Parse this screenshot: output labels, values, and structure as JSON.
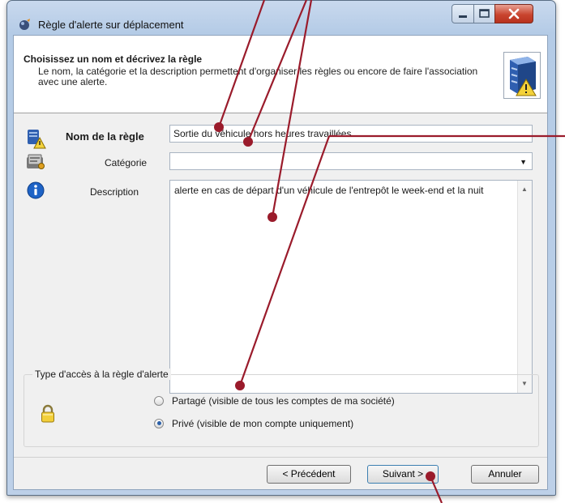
{
  "window": {
    "title": "Règle d'alerte sur déplacement",
    "controls": {
      "minimize": "minimize-icon",
      "maximize": "maximize-icon",
      "close": "close-icon"
    }
  },
  "header": {
    "title": "Choisissez un nom et décrivez la règle",
    "description": "Le nom, la catégorie et la description permettent d'organiser les règles ou encore de faire l'association avec une alerte."
  },
  "form": {
    "name_label": "Nom de la règle",
    "name_value": "Sortie du véhicule hors heures travaillées",
    "category_label": "Catégorie",
    "category_value": "",
    "description_label": "Description",
    "description_value": "alerte en cas de départ d'un véhicule de l'entrepôt le week-end et la nuit"
  },
  "access": {
    "legend": "Type d'accès à la règle d'alerte",
    "options": [
      {
        "label": "Partagé (visible de tous les comptes de ma société)",
        "selected": false
      },
      {
        "label": "Privé (visible de mon compte uniquement)",
        "selected": true
      }
    ]
  },
  "footer": {
    "prev_label": "< Précédent",
    "next_label": "Suivant >",
    "cancel_label": "Annuler"
  },
  "colors": {
    "annotation": "#9a1b2b",
    "window_frame": "#b4cbe6",
    "close_button": "#c9452f"
  }
}
